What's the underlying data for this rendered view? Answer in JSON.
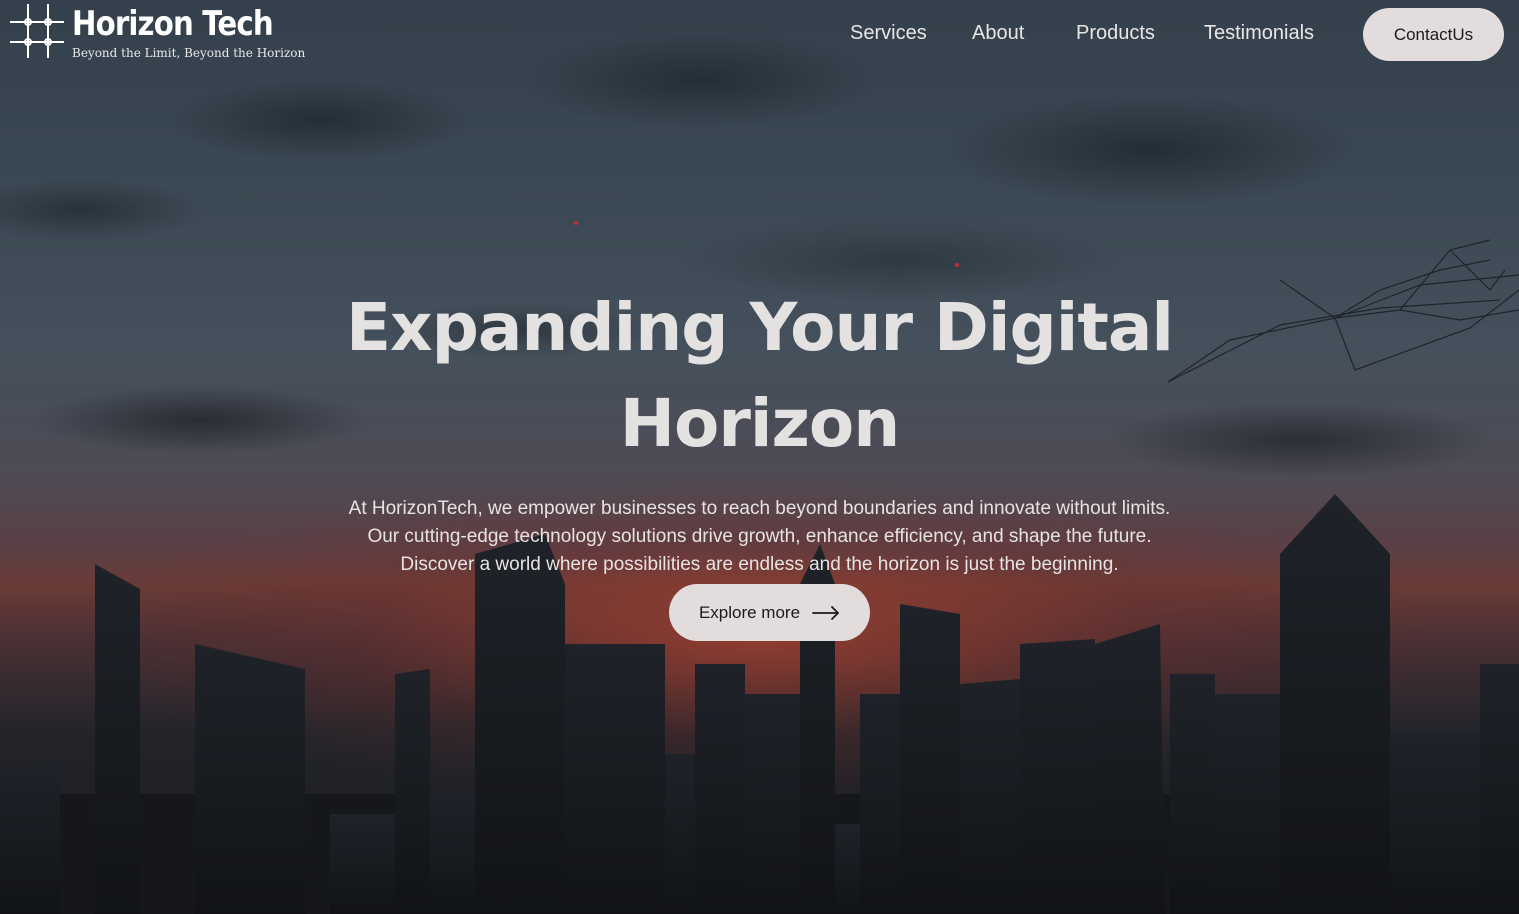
{
  "brand": {
    "name": "Horizon Tech",
    "tagline": "Beyond the Limit, Beyond the Horizon"
  },
  "nav": {
    "items": [
      {
        "label": "Services"
      },
      {
        "label": "About"
      },
      {
        "label": "Products"
      },
      {
        "label": "Testimonials"
      }
    ],
    "contact_label": "ContactUs"
  },
  "hero": {
    "title_lines": [
      "Expanding Your Digital",
      "Horizon"
    ],
    "description_lines": [
      "At HorizonTech, we empower businesses to reach beyond boundaries and innovate without limits.",
      "Our cutting-edge technology solutions drive growth, enhance efficiency, and shape the future.",
      "Discover a world where possibilities are endless and the horizon is just the beginning."
    ],
    "cta_label": "Explore more",
    "cta_icon": "arrow-right-icon",
    "background": "city-skyline-sunset-image"
  },
  "colors": {
    "button_bg": "#e3dcdc",
    "button_text": "#1d1a1a",
    "text_light": "#e4e1e1",
    "accent_dot": "#c0303a"
  }
}
